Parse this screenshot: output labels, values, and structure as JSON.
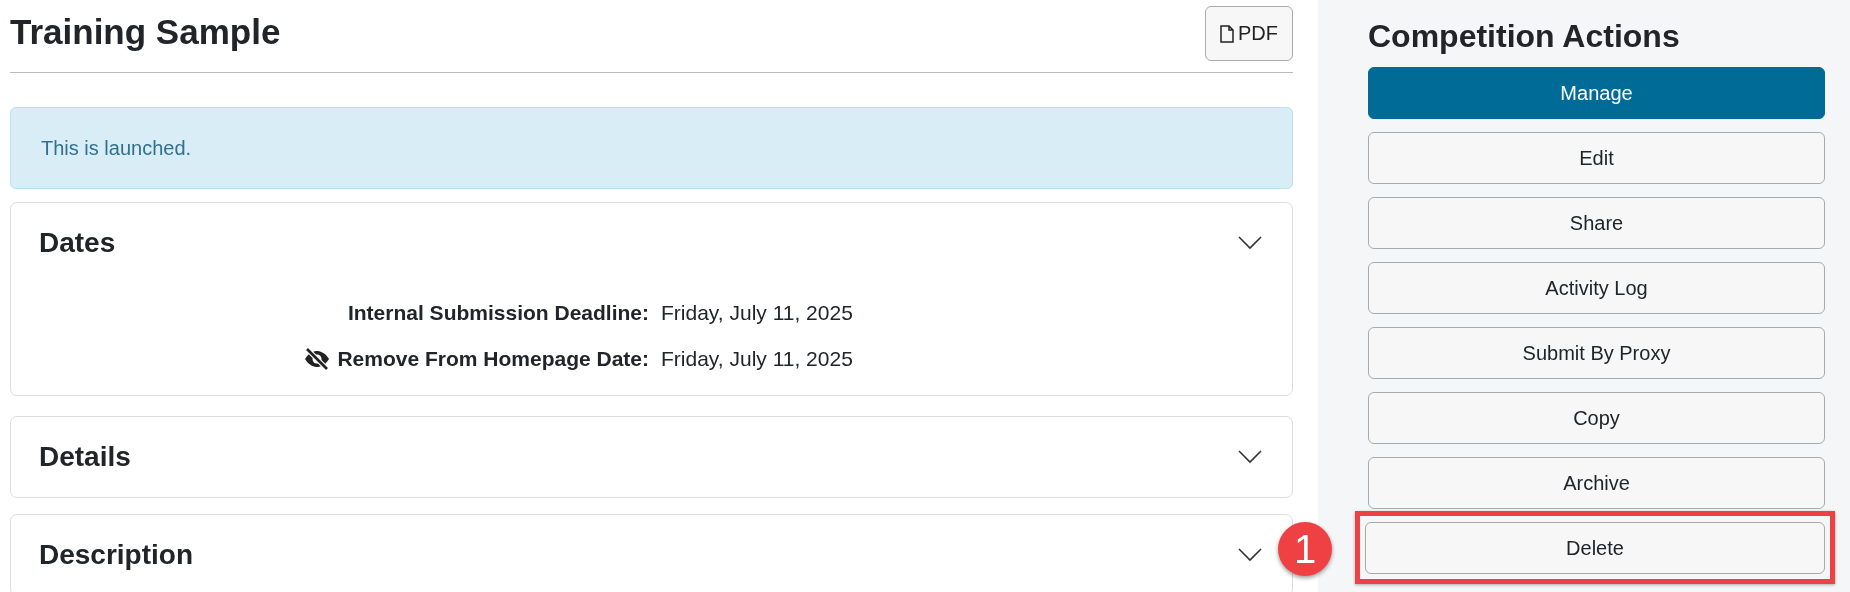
{
  "page": {
    "title": "Training Sample",
    "pdf_button": "PDF"
  },
  "alert": {
    "text": "This is launched."
  },
  "sections": [
    {
      "title": "Dates",
      "rows": [
        {
          "label": "Internal Submission Deadline:",
          "value": "Friday, July 11, 2025",
          "hidden": false
        },
        {
          "label": "Remove From Homepage Date:",
          "value": "Friday, July 11, 2025",
          "hidden": true
        }
      ]
    },
    {
      "title": "Details"
    },
    {
      "title": "Description"
    }
  ],
  "actions": {
    "title": "Competition Actions",
    "buttons": [
      {
        "label": "Manage",
        "kind": "primary",
        "highlighted": false
      },
      {
        "label": "Edit",
        "kind": "default",
        "highlighted": false
      },
      {
        "label": "Share",
        "kind": "default",
        "highlighted": false
      },
      {
        "label": "Activity Log",
        "kind": "default",
        "highlighted": false
      },
      {
        "label": "Submit By Proxy",
        "kind": "default",
        "highlighted": false
      },
      {
        "label": "Copy",
        "kind": "default",
        "highlighted": false
      },
      {
        "label": "Archive",
        "kind": "default",
        "highlighted": false
      },
      {
        "label": "Delete",
        "kind": "default",
        "highlighted": true,
        "callout": "1"
      }
    ]
  }
}
